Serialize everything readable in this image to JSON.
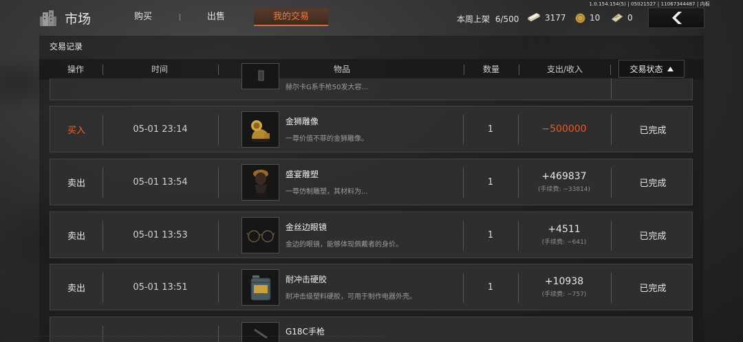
{
  "build_info": "1.0.154.154(5) | 05021527 | 11067344487 | 内标",
  "header": {
    "title": "市场",
    "tabs": [
      {
        "label": "购买"
      },
      {
        "label": "出售"
      },
      {
        "label": "我的交易"
      }
    ],
    "active_tab": "我的交易",
    "listing_label": "本周上架",
    "listing_value": "6/500",
    "currencies": {
      "cash": "3177",
      "coin": "10",
      "ticket": "0"
    },
    "back_icon": "chevron-left-icon"
  },
  "panel": {
    "title": "交易记录",
    "columns": {
      "op": "操作",
      "time": "时间",
      "item": "物品",
      "qty": "数量",
      "money": "支出/收入",
      "status": "交易状态"
    },
    "sort_icon": "triangle-up-icon"
  },
  "partial_top_row": {
    "desc": "赫尔卡G系手枪50发大容..."
  },
  "rows": [
    {
      "op": "买入",
      "time": "05-01 23:14",
      "name": "金狮雕像",
      "desc": "一尊价值不菲的金狮雕像。",
      "qty": "1",
      "money": "−500000",
      "fee": "",
      "status": "已完成"
    },
    {
      "op": "卖出",
      "time": "05-01 13:54",
      "name": "盛宴雕塑",
      "desc": "一尊仿制雕塑，其材料为...",
      "qty": "1",
      "money": "+469837",
      "fee": "(手续费: −33814)",
      "status": "已完成"
    },
    {
      "op": "卖出",
      "time": "05-01 13:53",
      "name": "金丝边眼镜",
      "desc": "金边的眼镜，能够体现佩戴者的身价。",
      "qty": "1",
      "money": "+4511",
      "fee": "(手续费: −641)",
      "status": "已完成"
    },
    {
      "op": "卖出",
      "time": "05-01 13:51",
      "name": "耐冲击硬胶",
      "desc": "耐冲击级塑料硬胶，可用于制作电器外壳。",
      "qty": "1",
      "money": "+10938",
      "fee": "(手续费: −757)",
      "status": "已完成"
    }
  ],
  "partial_bottom_row": {
    "name": "G18C手枪"
  },
  "colors": {
    "accent": "#e9692f",
    "negative": "#ea5a26"
  }
}
